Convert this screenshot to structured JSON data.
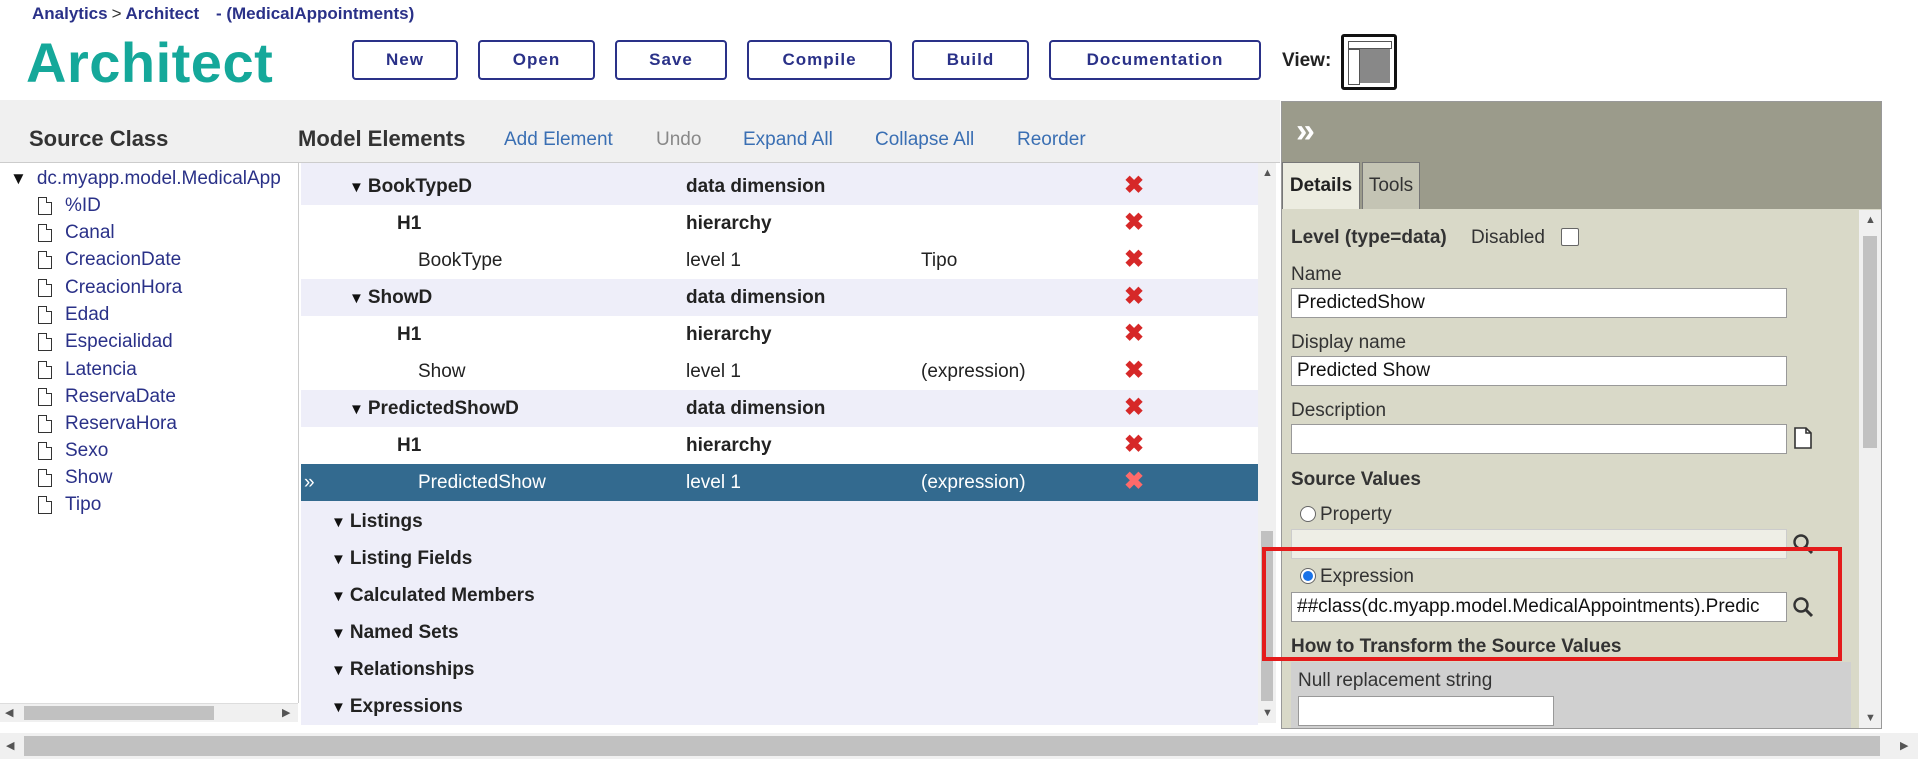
{
  "breadcrumb": {
    "item1": "Analytics",
    "sep": ">",
    "item2": "Architect",
    "cube": " - (MedicalAppointments)"
  },
  "app_title": "Architect",
  "toolbar": {
    "new": "New",
    "open": "Open",
    "save": "Save",
    "compile": "Compile",
    "build": "Build",
    "documentation": "Documentation",
    "view_label": "View:"
  },
  "source_class": {
    "title": "Source Class",
    "root": "dc.myapp.model.MedicalApp",
    "items": [
      "%ID",
      "Canal",
      "CreacionDate",
      "CreacionHora",
      "Edad",
      "Especialidad",
      "Latencia",
      "ReservaDate",
      "ReservaHora",
      "Sexo",
      "Show",
      "Tipo"
    ]
  },
  "model_elements": {
    "title": "Model Elements",
    "links": {
      "add": "Add Element",
      "undo": "Undo",
      "expand": "Expand All",
      "collapse": "Collapse All",
      "reorder": "Reorder"
    },
    "rows": [
      {
        "name": "BookTypeD",
        "type": "data dimension",
        "extra": ""
      },
      {
        "name": "H1",
        "type": "hierarchy",
        "extra": ""
      },
      {
        "name": "BookType",
        "type": "level 1",
        "extra": "Tipo"
      },
      {
        "name": "ShowD",
        "type": "data dimension",
        "extra": ""
      },
      {
        "name": "H1",
        "type": "hierarchy",
        "extra": ""
      },
      {
        "name": "Show",
        "type": "level 1",
        "extra": "(expression)"
      },
      {
        "name": "PredictedShowD",
        "type": "data dimension",
        "extra": ""
      },
      {
        "name": "H1",
        "type": "hierarchy",
        "extra": ""
      },
      {
        "name": "PredictedShow",
        "type": "level 1",
        "extra": "(expression)",
        "marker": "»"
      }
    ],
    "sections": [
      "Listings",
      "Listing Fields",
      "Calculated Members",
      "Named Sets",
      "Relationships",
      "Expressions"
    ]
  },
  "details": {
    "collapse": "»",
    "tab_details": "Details",
    "tab_tools": "Tools",
    "level_label": "Level (type=data)",
    "disabled_label": "Disabled",
    "name_label": "Name",
    "name_value": "PredictedShow",
    "display_label": "Display name",
    "display_value": "Predicted Show",
    "description_label": "Description",
    "description_value": "",
    "source_values_label": "Source Values",
    "property_label": "Property",
    "property_value": "",
    "expression_label": "Expression",
    "expression_value": "##class(dc.myapp.model.MedicalAppointments).Predic",
    "transform_label": "How to Transform the Source Values",
    "null_label": "Null replacement string",
    "null_value": ""
  },
  "colors": {
    "accent_teal": "#15a89a",
    "nav_blue": "#2a3188",
    "selected_row": "#336a8f",
    "delete_red": "#d62828",
    "highlight": "#e41b1b"
  }
}
